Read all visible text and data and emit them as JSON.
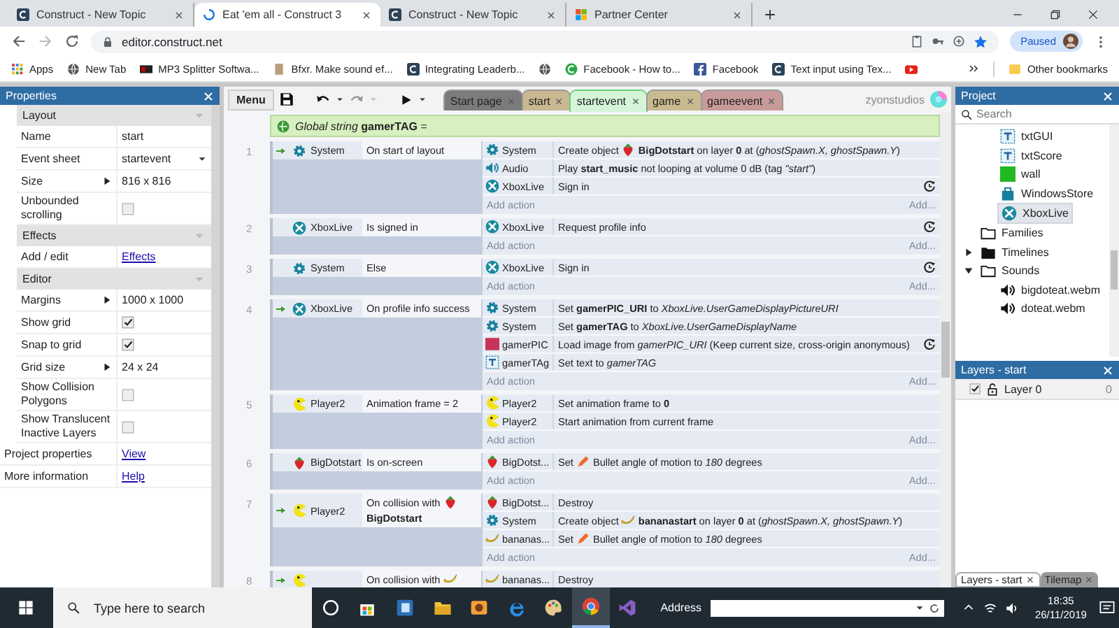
{
  "browser": {
    "tabs": [
      {
        "title": "Construct - New Topic",
        "kind": "construct",
        "selected": false
      },
      {
        "title": "Eat 'em all - Construct 3",
        "kind": "loading",
        "selected": true
      },
      {
        "title": "Construct - New Topic",
        "kind": "construct",
        "selected": false
      },
      {
        "title": "Partner Center",
        "kind": "microsoft",
        "selected": false
      }
    ],
    "url": "editor.construct.net",
    "profile_button": "Paused",
    "bookmarks": [
      {
        "label": "Apps",
        "kind": "apps"
      },
      {
        "label": "New Tab",
        "kind": "globe"
      },
      {
        "label": "MP3 Splitter Softwa...",
        "kind": "mp3"
      },
      {
        "label": "Bfxr. Make sound ef...",
        "kind": "doc"
      },
      {
        "label": "Integrating Leaderb...",
        "kind": "construct"
      },
      {
        "kind": "globe"
      },
      {
        "label": "Facebook - How to...",
        "kind": "cgreen"
      },
      {
        "label": "Facebook",
        "kind": "facebook"
      },
      {
        "label": "Text input using Tex...",
        "kind": "construct"
      },
      {
        "kind": "youtube"
      }
    ],
    "other_bookmarks": "Other bookmarks"
  },
  "properties": {
    "title": "Properties",
    "sections": [
      {
        "title": "Layout",
        "expanded": true,
        "rows": [
          {
            "label": "Name",
            "kind": "text",
            "value": "start"
          },
          {
            "label": "Event sheet",
            "kind": "dropdown",
            "value": "startevent"
          },
          {
            "label": "Size",
            "kind": "expand",
            "value": "816 x 816"
          },
          {
            "label": "Unbounded scrolling",
            "kind": "checkbox",
            "checked": false
          }
        ]
      },
      {
        "title": "Effects",
        "expanded": true,
        "rows": [
          {
            "label": "Add / edit",
            "kind": "link",
            "value": "Effects"
          }
        ]
      },
      {
        "title": "Editor",
        "expanded": true,
        "rows": [
          {
            "label": "Margins",
            "kind": "expand",
            "value": "1000 x 1000"
          },
          {
            "label": "Show grid",
            "kind": "checkbox",
            "checked": true
          },
          {
            "label": "Snap to grid",
            "kind": "checkbox",
            "checked": true
          },
          {
            "label": "Grid size",
            "kind": "expand",
            "value": "24 x 24"
          },
          {
            "label": "Show Collision Polygons",
            "kind": "checkbox",
            "checked": false
          },
          {
            "label": "Show Translucent Inactive Layers",
            "kind": "checkbox",
            "checked": false
          }
        ]
      }
    ],
    "footer_rows": [
      {
        "label": "Project properties",
        "kind": "link",
        "value": "View"
      },
      {
        "label": "More information",
        "kind": "link",
        "value": "Help"
      }
    ]
  },
  "editor": {
    "menu": "Menu",
    "tabs": [
      {
        "label": "Start page",
        "color": "#7b7b7b",
        "selected": false
      },
      {
        "label": "start",
        "color": "#c9b892",
        "selected": false
      },
      {
        "label": "startevent",
        "color": "#d4f5d8",
        "selected": true
      },
      {
        "label": "game",
        "color": "#c9bb90",
        "selected": false
      },
      {
        "label": "gameevent",
        "color": "#c99a9a",
        "selected": false
      }
    ],
    "user": "zyonstudios"
  },
  "event_sheet": {
    "global": "*Global string* **gamerTAG** =",
    "events": [
      {
        "number": "1",
        "trigger": true,
        "conditions": [
          {
            "kind": "gear",
            "object": "System",
            "parts": [
              {
                "kind": "text",
                "text": "On start of layout"
              }
            ]
          }
        ],
        "actions": [
          {
            "kind": "gear",
            "object": "System",
            "async": false,
            "parts": [
              {
                "kind": "text",
                "text": "Create object"
              },
              {
                "kind": "strawberry"
              },
              {
                "kind": "text",
                "text": "**BigDotstart** on layer **0** at (*ghostSpawn.X, ghostSpawn.Y*)"
              }
            ]
          },
          {
            "kind": "speaker",
            "object": "Audio",
            "async": false,
            "parts": [
              {
                "kind": "text",
                "text": "Play **start_music** not looping at volume 0 dB (tag *\"start\"*)"
              }
            ]
          },
          {
            "kind": "xbox",
            "object": "XboxLive",
            "async": true,
            "parts": [
              {
                "kind": "text",
                "text": "Sign in"
              }
            ]
          }
        ],
        "add_action": "Add action",
        "add_more": "Add..."
      },
      {
        "number": "2",
        "trigger": false,
        "conditions": [
          {
            "kind": "xbox",
            "object": "XboxLive",
            "parts": [
              {
                "kind": "text",
                "text": "Is signed in"
              }
            ]
          }
        ],
        "actions": [
          {
            "kind": "xbox",
            "object": "XboxLive",
            "async": true,
            "parts": [
              {
                "kind": "text",
                "text": "Request profile info"
              }
            ]
          }
        ],
        "add_action": "Add action",
        "add_more": "Add..."
      },
      {
        "number": "3",
        "trigger": false,
        "conditions": [
          {
            "kind": "gear",
            "object": "System",
            "parts": [
              {
                "kind": "text",
                "text": "Else"
              }
            ]
          }
        ],
        "actions": [
          {
            "kind": "xbox",
            "object": "XboxLive",
            "async": true,
            "parts": [
              {
                "kind": "text",
                "text": "Sign in"
              }
            ]
          }
        ],
        "add_action": "Add action",
        "add_more": "Add..."
      },
      {
        "number": "4",
        "trigger": true,
        "conditions": [
          {
            "kind": "xbox",
            "object": "XboxLive",
            "parts": [
              {
                "kind": "text",
                "text": "On profile info success"
              }
            ]
          }
        ],
        "actions": [
          {
            "kind": "gear",
            "object": "System",
            "async": false,
            "parts": [
              {
                "kind": "text",
                "text": "Set **gamerPIC_URI** to *XboxLive.UserGameDisplayPictureURI*"
              }
            ]
          },
          {
            "kind": "gear",
            "object": "System",
            "async": false,
            "parts": [
              {
                "kind": "text",
                "text": "Set **gamerTAG** to *XboxLive.UserGameDisplayName*"
              }
            ]
          },
          {
            "kind": "pic",
            "object": "gamerPIC",
            "async": true,
            "parts": [
              {
                "kind": "text",
                "text": "Load image from *gamerPIC_URI* (Keep current size, cross-origin anonymous)"
              }
            ]
          },
          {
            "kind": "textobj",
            "object": "gamerTAg",
            "async": false,
            "parts": [
              {
                "kind": "text",
                "text": "Set text to *gamerTAG*"
              }
            ]
          }
        ],
        "add_action": "Add action",
        "add_more": "Add..."
      },
      {
        "number": "5",
        "trigger": false,
        "conditions": [
          {
            "kind": "pacman",
            "object": "Player2",
            "parts": [
              {
                "kind": "text",
                "text": "Animation frame = 2"
              }
            ]
          }
        ],
        "actions": [
          {
            "kind": "pacman",
            "object": "Player2",
            "async": false,
            "parts": [
              {
                "kind": "text",
                "text": "Set animation frame to **0**"
              }
            ]
          },
          {
            "kind": "pacman",
            "object": "Player2",
            "async": false,
            "parts": [
              {
                "kind": "text",
                "text": "Start animation from current frame"
              }
            ]
          }
        ],
        "add_action": "Add action",
        "add_more": "Add..."
      },
      {
        "number": "6",
        "trigger": false,
        "conditions": [
          {
            "kind": "strawberry",
            "object": "BigDotstart",
            "parts": [
              {
                "kind": "text",
                "text": "Is on-screen"
              }
            ]
          }
        ],
        "actions": [
          {
            "kind": "strawberry",
            "object": "BigDotst...",
            "async": false,
            "parts": [
              {
                "kind": "text",
                "text": "Set"
              },
              {
                "kind": "bullet"
              },
              {
                "kind": "text",
                "text": "Bullet angle of motion to *180* degrees"
              }
            ]
          }
        ],
        "add_action": "Add action",
        "add_more": "Add..."
      },
      {
        "number": "7",
        "trigger": true,
        "conditions": [
          {
            "kind": "pacman",
            "object": "Player2",
            "parts": [
              {
                "kind": "text",
                "text": "On collision with"
              },
              {
                "kind": "strawberry"
              },
              {
                "kind": "text",
                "text": "**BigDotstart**"
              }
            ]
          }
        ],
        "actions": [
          {
            "kind": "strawberry",
            "object": "BigDotst...",
            "async": false,
            "parts": [
              {
                "kind": "text",
                "text": "Destroy"
              }
            ]
          },
          {
            "kind": "gear",
            "object": "System",
            "async": false,
            "parts": [
              {
                "kind": "text",
                "text": "Create object"
              },
              {
                "kind": "banana"
              },
              {
                "kind": "text",
                "text": "**bananastart** on layer **0** at (*ghostSpawn.X, ghostSpawn.Y*)"
              }
            ]
          },
          {
            "kind": "banana",
            "object": "bananas...",
            "async": false,
            "parts": [
              {
                "kind": "text",
                "text": "Set"
              },
              {
                "kind": "bullet"
              },
              {
                "kind": "text",
                "text": "Bullet angle of motion to *180* degrees"
              }
            ]
          }
        ],
        "add_action": "Add action",
        "add_more": "Add..."
      },
      {
        "number": "8",
        "trigger": true,
        "conditions": [
          {
            "kind": "pacman",
            "parts": [
              {
                "kind": "text",
                "text": "On collision with"
              },
              {
                "kind": "banana"
              }
            ]
          }
        ],
        "actions": [
          {
            "kind": "banana",
            "object": "bananas...",
            "async": false,
            "parts": [
              {
                "kind": "text",
                "text": "Destroy"
              }
            ]
          }
        ]
      }
    ]
  },
  "project": {
    "title": "Project",
    "search_placeholder": "Search",
    "tree": [
      {
        "children": [
          {
            "label": "txtGUI",
            "kind": "textobj",
            "selected": false
          },
          {
            "label": "txtScore",
            "kind": "textobj",
            "selected": false
          },
          {
            "label": "wall",
            "kind": "greensq",
            "selected": false
          },
          {
            "label": "WindowsStore",
            "kind": "store",
            "selected": false
          },
          {
            "label": "XboxLive",
            "kind": "xbox",
            "selected": true
          }
        ]
      },
      {
        "label": "Families",
        "kind": "folder",
        "selected": false
      },
      {
        "label": "Timelines",
        "kind": "folderfill",
        "selected": false,
        "expanded": false
      },
      {
        "label": "Sounds",
        "kind": "folder",
        "selected": false,
        "expanded": true,
        "children": [
          {
            "label": "bigdoteat.webm",
            "kind": "sound",
            "selected": false
          },
          {
            "label": "doteat.webm",
            "kind": "sound",
            "selected": false
          }
        ]
      }
    ]
  },
  "layers": {
    "title": "Layers - start",
    "items": [
      {
        "name": "Layer 0",
        "visible": true,
        "count": "0"
      }
    ],
    "tabs": [
      {
        "label": "Layers - start",
        "selected": true
      },
      {
        "label": "Tilemap",
        "selected": false
      }
    ]
  },
  "taskbar": {
    "search_placeholder": "Type here to search",
    "apps": [
      {
        "kind": "cortana",
        "selected": false
      },
      {
        "kind": "bag",
        "selected": false
      },
      {
        "kind": "appblue",
        "selected": false
      },
      {
        "kind": "explorer",
        "selected": false
      },
      {
        "kind": "paint",
        "selected": false
      },
      {
        "kind": "edge",
        "selected": false
      },
      {
        "kind": "palette",
        "selected": false
      },
      {
        "kind": "chrome",
        "selected": true
      },
      {
        "kind": "vs",
        "selected": false
      }
    ],
    "address_label": "Address",
    "time": "18:35",
    "date": "26/11/2019"
  }
}
